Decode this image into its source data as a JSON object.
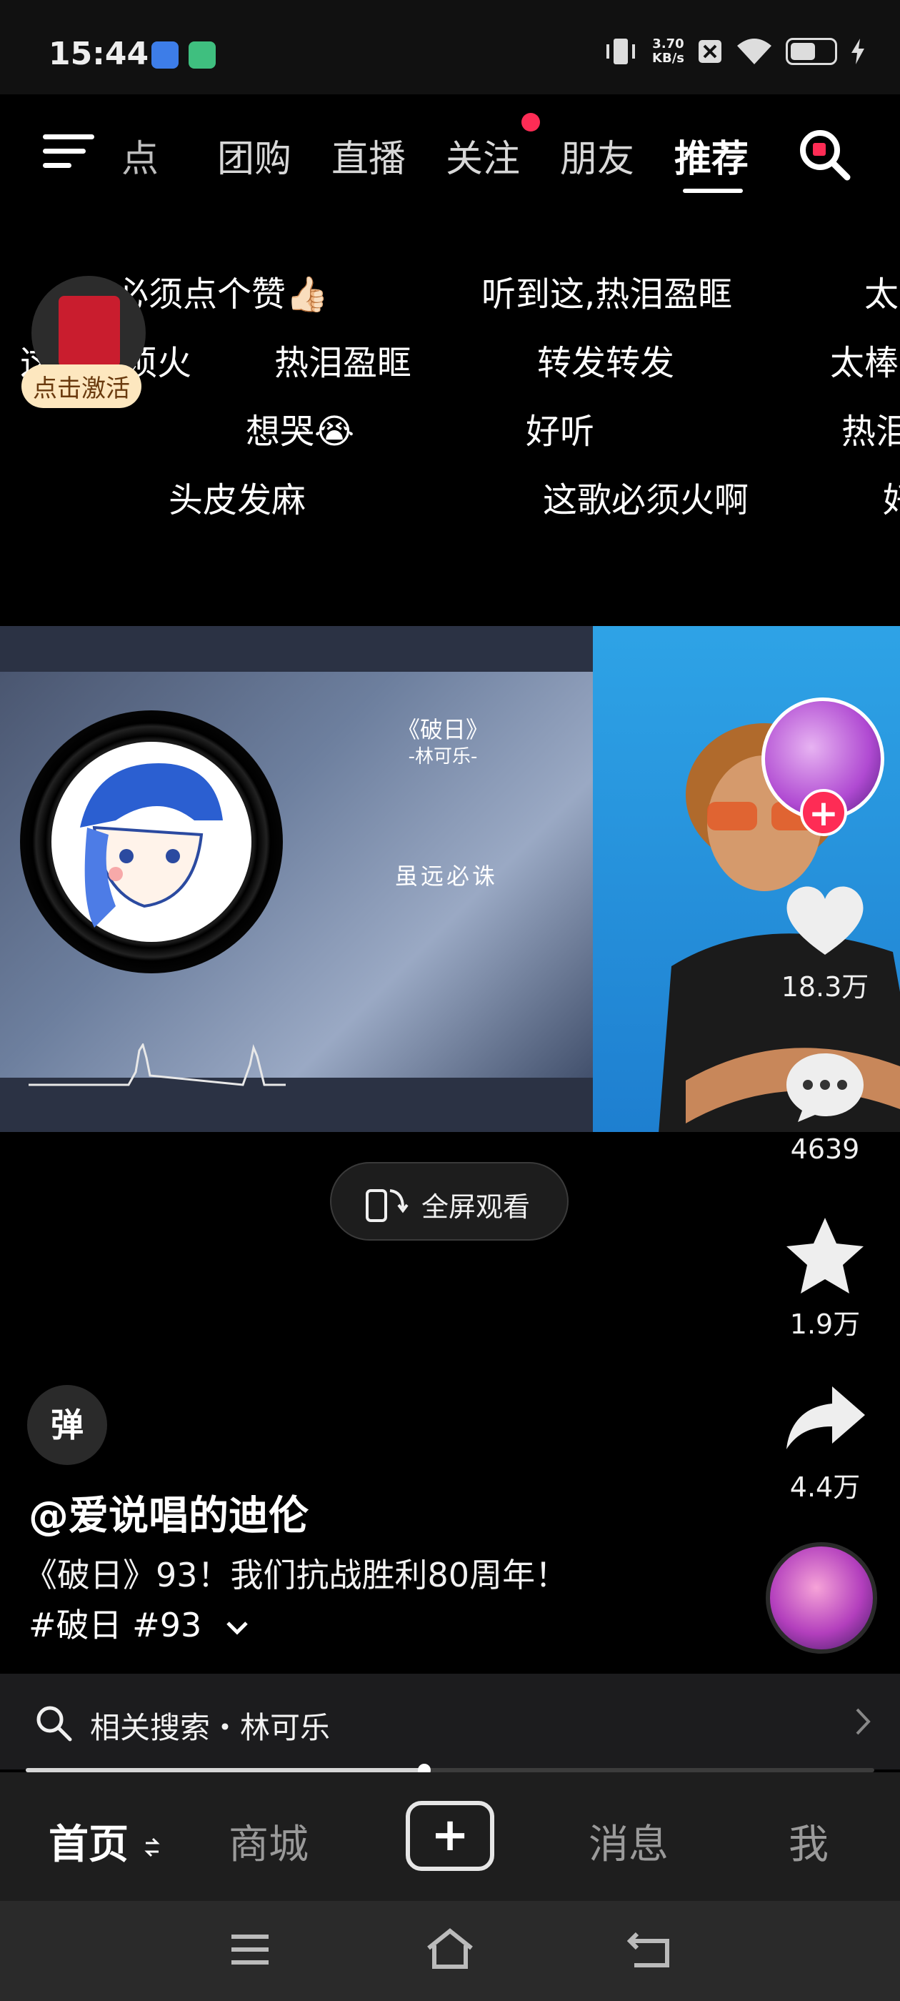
{
  "status_bar": {
    "time": "15:44",
    "net_speed_value": "3.70",
    "net_speed_unit": "KB/s",
    "icons": [
      "vibrate-icon",
      "no-sim-icon",
      "wifi-icon",
      "battery-icon",
      "charging-icon"
    ]
  },
  "top_nav": {
    "tabs": [
      {
        "label": "热点",
        "visible": "点"
      },
      {
        "label": "团购"
      },
      {
        "label": "直播"
      },
      {
        "label": "关注",
        "has_dot": true
      },
      {
        "label": "朋友"
      },
      {
        "label": "推荐",
        "active": true
      }
    ]
  },
  "red_packet": {
    "label": "点击激活"
  },
  "danmaku": [
    "必须点个赞👍🏻",
    "听到这,热泪盈眶",
    "太",
    "这歌必须火",
    "热泪盈眶",
    "转发转发",
    "太棒",
    "想哭😭",
    "好听",
    "热泪",
    "头皮发麻",
    "这歌必须火啊",
    "好"
  ],
  "video": {
    "song_title": "《破日》",
    "song_artist": "-林可乐-",
    "lyric": "虽远必诛"
  },
  "fullscreen_label": "全屏观看",
  "rail": {
    "like_count": "18.3万",
    "comment_count": "4639",
    "favorite_count": "1.9万",
    "share_count": "4.4万"
  },
  "danmu_toggle": "弹",
  "author": "@爱说唱的迪伦",
  "description": "《破日》93！我们抗战胜利80周年！",
  "tags": "#破日 #93",
  "related_search": {
    "label": "相关搜索・林可乐"
  },
  "playback_progress": 0.47,
  "bottom_nav": {
    "home": "首页",
    "mall": "商城",
    "messages": "消息",
    "me": "我"
  },
  "colors": {
    "accent": "#fe2c55",
    "background": "#000000"
  }
}
